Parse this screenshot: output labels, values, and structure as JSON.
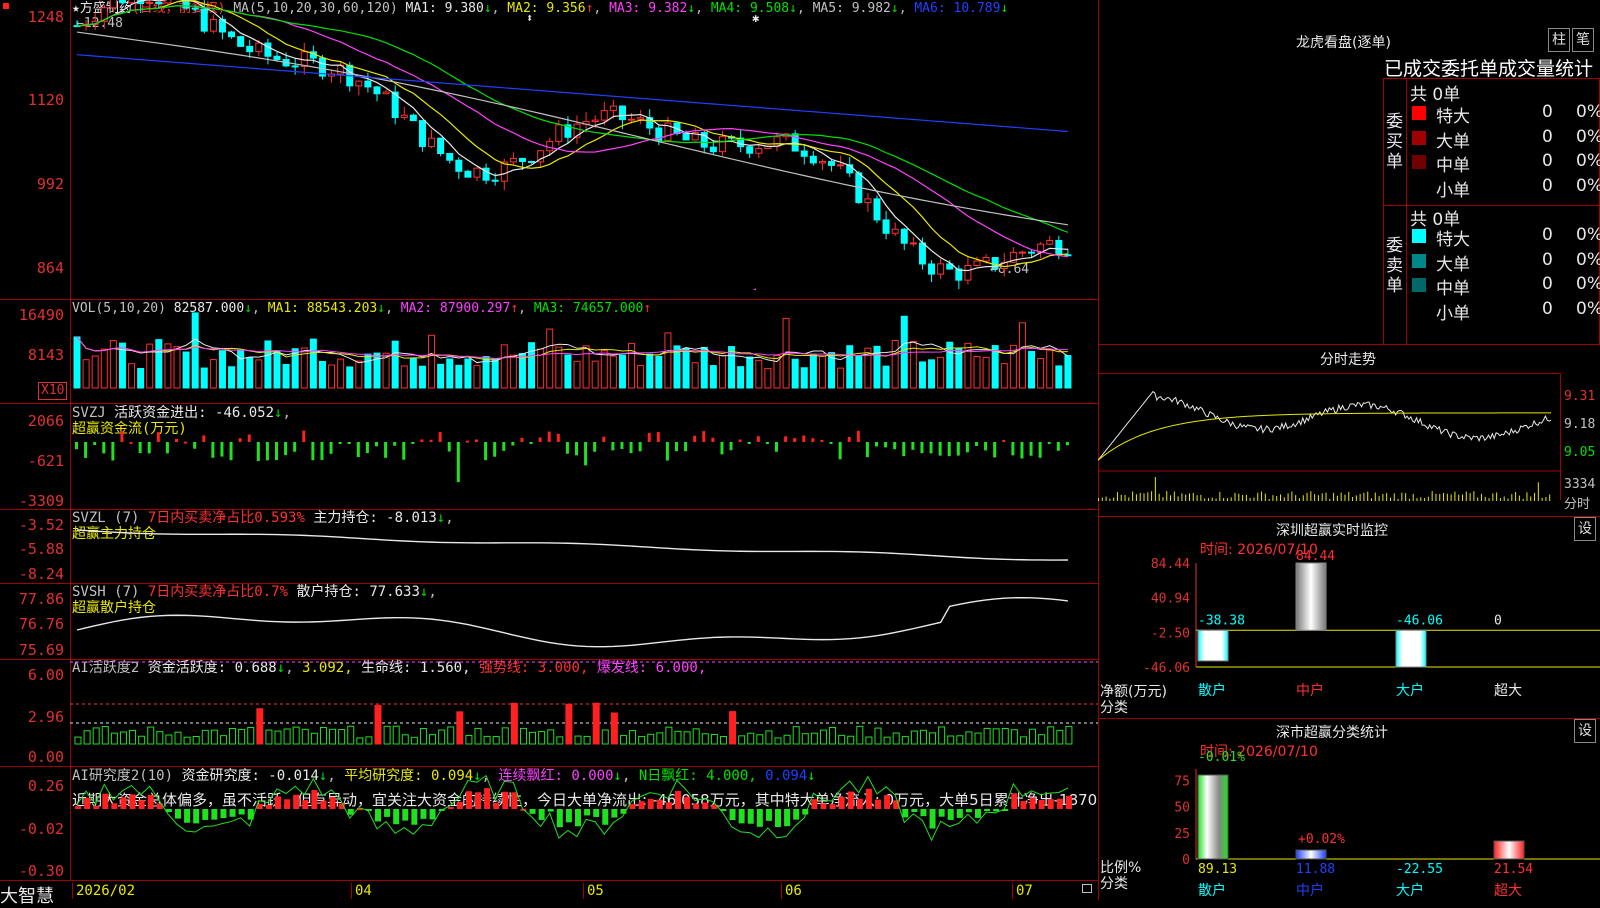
{
  "main": {
    "stock": "方盛制药",
    "star": "★",
    "mode": "(日线，前复权)",
    "ma_label": "MA(5,10,20,30,60,120)",
    "ma": [
      {
        "t": "MA1: 9.380",
        "c": "#e8e8e8",
        "arrow": "↓",
        "ac": "#00e000"
      },
      {
        "t": "MA2: 9.356",
        "c": "#e8e800",
        "arrow": "↑",
        "ac": "#ff3030"
      },
      {
        "t": "MA3: 9.382",
        "c": "#ff40ff",
        "arrow": "↓",
        "ac": "#00e000"
      },
      {
        "t": "MA4: 9.508",
        "c": "#00e000",
        "arrow": "↓",
        "ac": "#00e000"
      },
      {
        "t": "MA5: 9.982",
        "c": "#c0c0c0",
        "arrow": "↓",
        "ac": "#00e000"
      },
      {
        "t": "MA6: 10.789",
        "c": "#2040ff",
        "arrow": "↓",
        "ac": "#00e000"
      }
    ],
    "hi_label": "12.48",
    "lo_label": "8.64",
    "y": [
      "1248",
      "1120",
      "992",
      "864"
    ]
  },
  "vol": {
    "h": "VOL(5,10,20)",
    "v": "82587.000",
    "ma1": "MA1: 88543.203",
    "ma2": "MA2: 87900.297",
    "ma3": "MA3: 74657.000",
    "y": [
      "16490",
      "8143"
    ],
    "unit": "X10"
  },
  "svzj": {
    "h": "SVZJ",
    "desc": "活跃资金进出: -46.052",
    "sub": "超赢资金流(万元)",
    "y": [
      "2066",
      "-621",
      "-3309"
    ]
  },
  "svzl": {
    "h": "SVZL (7)",
    "ratio": "7日内买卖净占比0.593%",
    "hold": "主力持仓: -8.013",
    "sub": "超赢主力持仓",
    "y": [
      "-3.52",
      "-5.88",
      "-8.24"
    ]
  },
  "svsh": {
    "h": "SVSH (7)",
    "ratio": "7日内买卖净占比0.7%",
    "hold": "散户持仓: 77.633",
    "sub": "超赢散户持仓",
    "y": [
      "77.86",
      "76.76",
      "75.69"
    ]
  },
  "ai": {
    "h": "AI活跃度2",
    "a": "资金活跃度: 0.688",
    "b": "3.092,",
    "c": "生命线: 1.560,",
    "d": "强势线: 3.000,",
    "e": "爆发线: 6.000,",
    "y": [
      "6.00",
      "2.96",
      "0.00"
    ]
  },
  "ai2": {
    "h": "AI研究度2(10)",
    "a": "资金研究度: -0.014",
    "b": "平均研究度: 0.094",
    "c": "连续飘红: 0.000",
    "d": "N日飘红: 4.000,",
    "e": "0.094",
    "text": "近期大资金总体偏多，虽不活跃，但有异动，宜关注大资金的持续性，今日大单净流出: -46.058万元，其中特大单净流入: 0万元，大单5日累计净出-1870",
    "y": [
      "0.26",
      "-0.02",
      "-0.30"
    ]
  },
  "xaxis": [
    "2026/02",
    "04",
    "05",
    "06",
    "07"
  ],
  "bottom_label": "大智慧",
  "dragon": {
    "title": "龙虎看盘(逐单)",
    "btn1": "柱",
    "btn2": "笔",
    "tabs": "已成交委托单成交量统计",
    "buy_side": "委买单",
    "sell_side": "委卖单",
    "buy_total": "共 0单",
    "sell_total": "共 0单",
    "buy_rows": [
      {
        "n": "特大",
        "v": "0",
        "p": "0%",
        "c": "#ff0000"
      },
      {
        "n": "大单",
        "v": "0",
        "p": "0%",
        "c": "#a00000"
      },
      {
        "n": "中单",
        "v": "0",
        "p": "0%",
        "c": "#700000"
      },
      {
        "n": "小单",
        "v": "0",
        "p": "0%",
        "c": ""
      }
    ],
    "sell_rows": [
      {
        "n": "特大",
        "v": "0",
        "p": "0%",
        "c": "#00ffff"
      },
      {
        "n": "大单",
        "v": "0",
        "p": "0%",
        "c": "#008888"
      },
      {
        "n": "中单",
        "v": "0",
        "p": "0%",
        "c": "#006868"
      },
      {
        "n": "小单",
        "v": "0",
        "p": "0%",
        "c": ""
      }
    ]
  },
  "intraday": {
    "title": "分时走势",
    "y": [
      "9.31",
      "9.18",
      "9.05"
    ],
    "vol": "3334",
    "unit": "分时"
  },
  "monitor": {
    "title": "深圳超赢实时监控",
    "btn": "设",
    "time": "时间: 2026/07/10",
    "y": [
      "84.44",
      "40.94",
      "-2.50",
      "-46.06"
    ],
    "ylabel": "净额(万元)",
    "xlabel": "分类",
    "bars": [
      {
        "k": "散户",
        "v": "-38.38"
      },
      {
        "k": "中户",
        "v": "84.44"
      },
      {
        "k": "大户",
        "v": "-46.06"
      },
      {
        "k": "超大",
        "v": "0"
      }
    ]
  },
  "classify": {
    "title": "深市超赢分类统计",
    "btn": "设",
    "time": "时间: 2026/07/10",
    "y": [
      "75",
      "50",
      "25",
      "0"
    ],
    "ylabel": "比例%",
    "xlabel": "分类",
    "top": [
      "-0.01%",
      "+0.02%"
    ],
    "bars": [
      {
        "k": "散户",
        "v": "89.13"
      },
      {
        "k": "中户",
        "v": "11.88"
      },
      {
        "k": "大户",
        "v": "-22.55"
      },
      {
        "k": "超大",
        "v": "21.54"
      }
    ]
  }
}
